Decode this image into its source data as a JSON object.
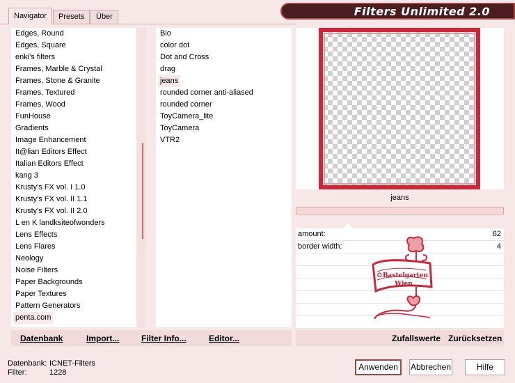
{
  "app": {
    "title": "Filters Unlimited 2.0"
  },
  "tabs": [
    {
      "label": "Navigator",
      "active": true
    },
    {
      "label": "Presets",
      "active": false
    },
    {
      "label": "Über",
      "active": false
    }
  ],
  "categories": [
    "Edges, Round",
    "Edges, Square",
    "enki's filters",
    "Frames, Marble & Crystal",
    "Frames, Stone & Granite",
    "Frames, Textured",
    "Frames, Wood",
    "FunHouse",
    "Gradients",
    "Image Enhancement",
    "It@lian Editors Effect",
    "Italian Editors Effect",
    "kang 3",
    "Krusty's FX vol. I 1.0",
    "Krusty's FX vol. II 1.1",
    "Krusty's FX vol. II 2.0",
    "L en K landksiteofwonders",
    "Lens Effects",
    "Lens Flares",
    "Neology",
    "Noise Filters",
    "Paper Backgrounds",
    "Paper Textures",
    "Pattern Generators",
    "penta.com"
  ],
  "selected_category": "penta.com",
  "filters": [
    "Bio",
    "color dot",
    "Dot and Cross",
    "drag",
    "jeans",
    "rounded corner anti-aliased",
    "rounded corner",
    "ToyCamera_lite",
    "ToyCamera",
    "VTR2"
  ],
  "selected_filter": "jeans",
  "preview": {
    "filter_name": "jeans",
    "progress": 0
  },
  "params": [
    {
      "label": "amount:",
      "value": "62"
    },
    {
      "label": "border width:",
      "value": "4"
    }
  ],
  "watermark": {
    "line1": "©Bastelgarten",
    "line2": "Wien"
  },
  "left_buttons": {
    "datenbank": "Datenbank",
    "import": "Import...",
    "filter_info": "Filter Info...",
    "editor": "Editor..."
  },
  "right_buttons": {
    "random": "Zufallswerte",
    "reset": "Zurücksetzen"
  },
  "status": {
    "db_label": "Datenbank:",
    "db_value": "ICNET-Filters",
    "filter_label": "Filter:",
    "filter_value": "1228"
  },
  "dialog_buttons": {
    "apply": "Anwenden",
    "cancel": "Abbrechen",
    "help": "Hilfe"
  },
  "colors": {
    "accent": "#c8283a",
    "header_bg": "#4a1e1e",
    "window_bg": "#f7e7e7"
  }
}
